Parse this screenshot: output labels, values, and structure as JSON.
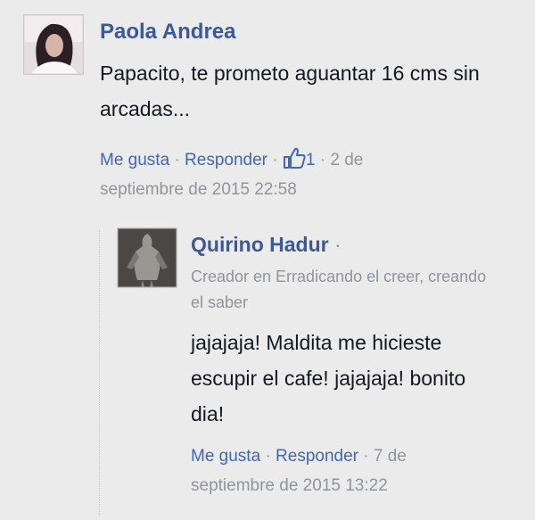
{
  "comment": {
    "author": "Paola Andrea",
    "text": "Papacito, te prometo aguantar 16 cms sin arcadas...",
    "like_label": "Me gusta",
    "reply_label": "Responder",
    "like_count": "1",
    "timestamp_part1": "2 de",
    "timestamp_part2": "septiembre de 2015 22:58"
  },
  "reply": {
    "author": "Quirino Hadur",
    "author_suffix": "·",
    "subtitle": "Creador en Erradicando el creer, creando el saber",
    "text": "jajajaja! Maldita me hicieste escupir el cafe! jajajaja! bonito dia!",
    "like_label": "Me gusta",
    "reply_label": "Responder",
    "timestamp_part1": "7 de",
    "timestamp_part2": "septiembre de 2015 13:22"
  },
  "separator": "·",
  "icons": {
    "like": "thumbs-up-icon"
  },
  "colors": {
    "link": "#4267b2",
    "name": "#3b5998",
    "meta": "#90949c",
    "text": "#141823",
    "background": "#ebebeb"
  }
}
